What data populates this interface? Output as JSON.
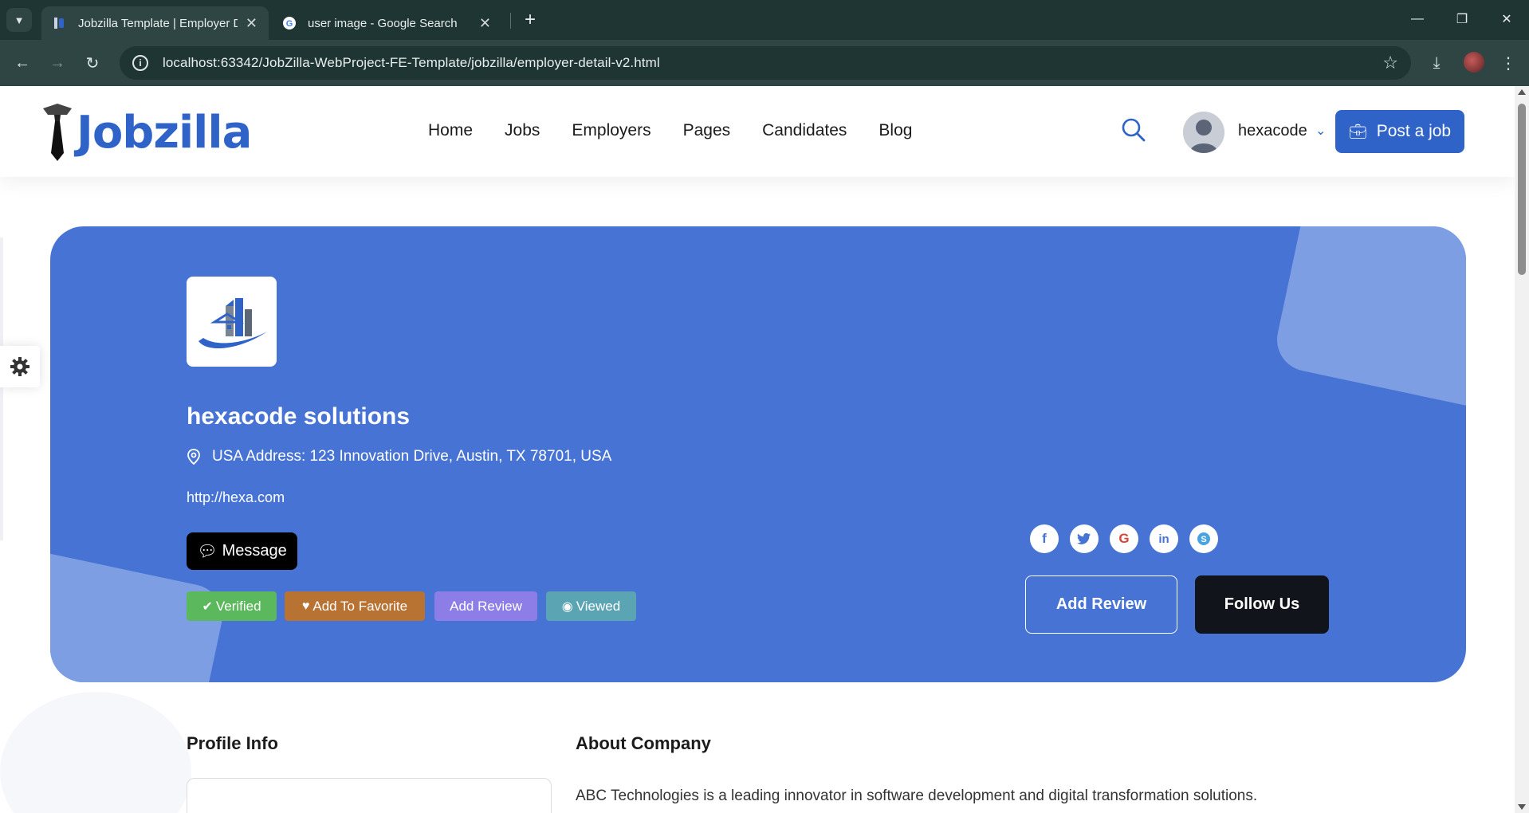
{
  "browser": {
    "tabs": [
      {
        "title": "Jobzilla Template | Employer De",
        "active": true,
        "favicon": "jobzilla-favicon-icon"
      },
      {
        "title": "user image - Google Search",
        "active": false,
        "favicon": "google-g-icon"
      }
    ],
    "url": "localhost:63342/JobZilla-WebProject-FE-Template/jobzilla/employer-detail-v2.html"
  },
  "header": {
    "brand": "Jobzilla",
    "nav": [
      "Home",
      "Jobs",
      "Employers",
      "Pages",
      "Candidates",
      "Blog"
    ],
    "user_name": "hexacode",
    "post_job_label": "Post a job"
  },
  "hero": {
    "company_name": "hexacode solutions",
    "address": "USA Address: 123 Innovation Drive, Austin, TX 78701, USA",
    "website": "http://hexa.com",
    "message_label": "Message",
    "badges": {
      "verified": "Verified",
      "favorite": "Add To Favorite",
      "review": "Add Review",
      "viewed": "Viewed"
    },
    "social": [
      "facebook-icon",
      "twitter-icon",
      "google-icon",
      "linkedin-icon",
      "skype-icon"
    ],
    "add_review_label": "Add Review",
    "follow_label": "Follow Us"
  },
  "content": {
    "profile_info_title": "Profile Info",
    "about_title": "About Company",
    "about_text": "ABC Technologies is a leading innovator in software development and digital transformation solutions."
  },
  "colors": {
    "brand": "#2f63c8",
    "hero_bg": "#4673d4",
    "verified": "#5cb85c",
    "favorite": "#b87333",
    "review": "#8c7ee6",
    "viewed": "#5ba4b4"
  }
}
